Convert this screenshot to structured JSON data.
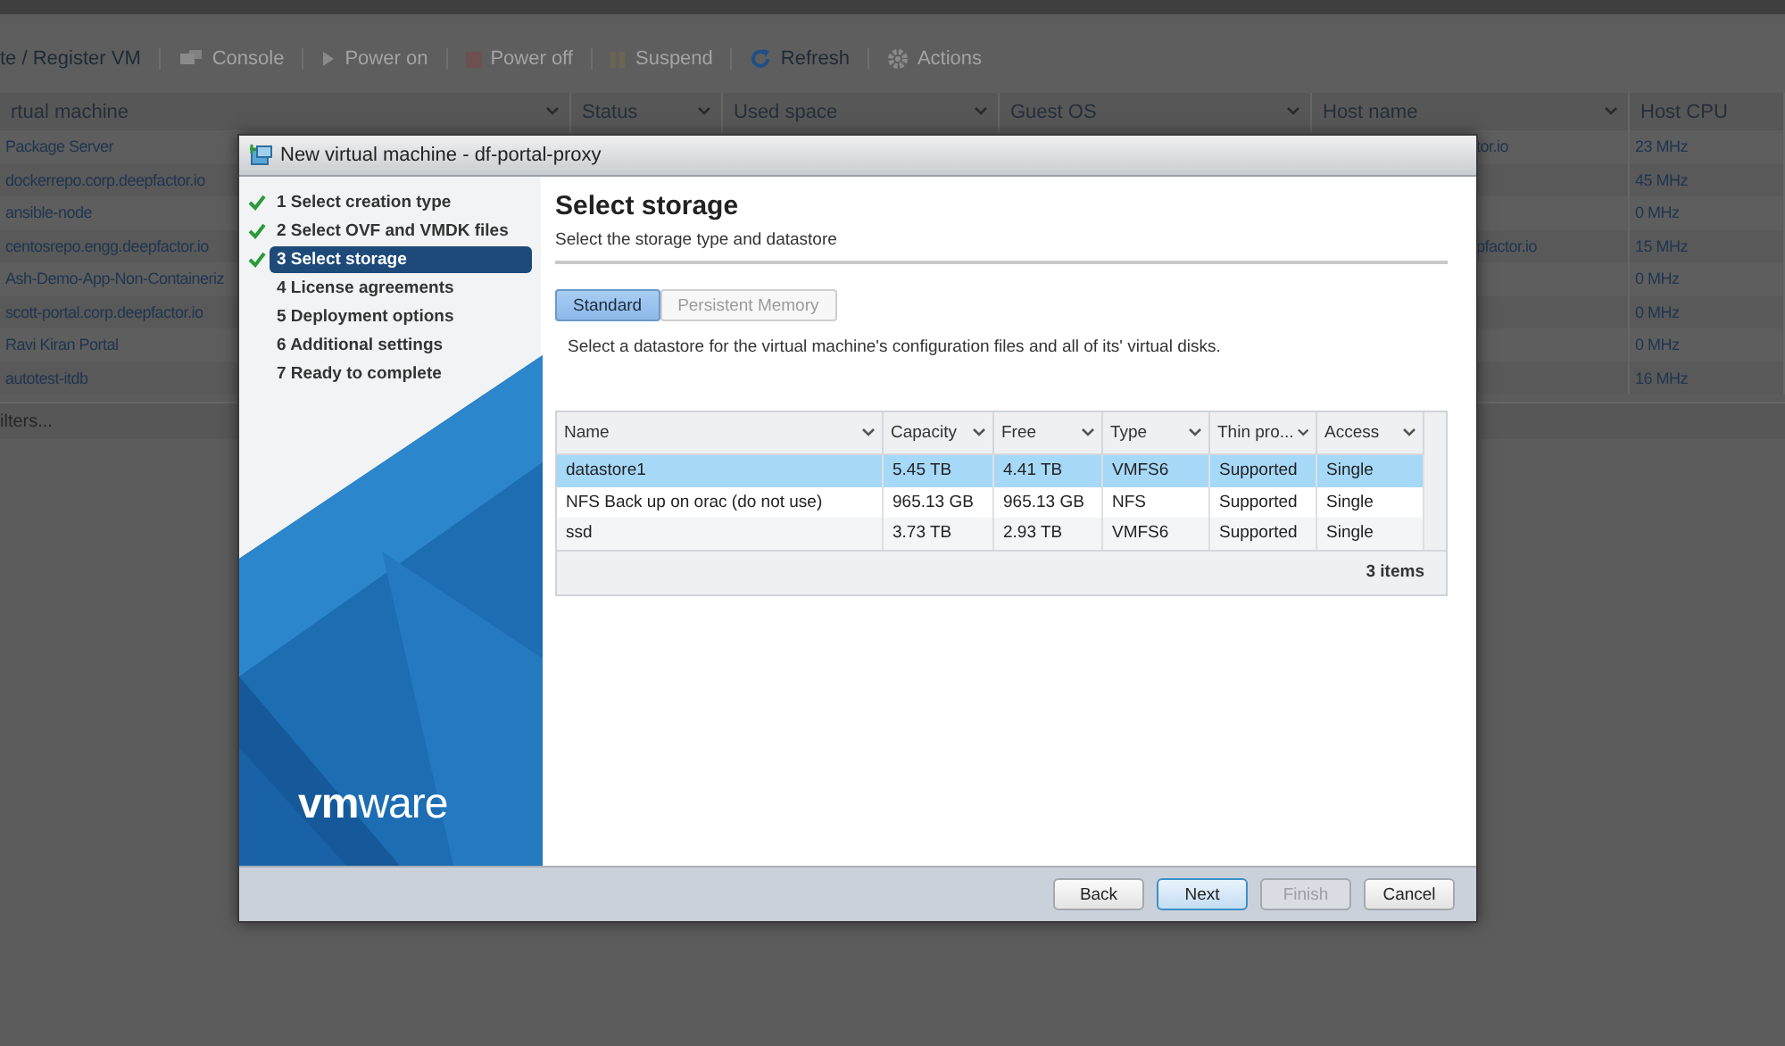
{
  "toolbar": [
    {
      "label": "te / Register VM",
      "kind": "plain",
      "disabled": false
    },
    {
      "label": "Console",
      "kind": "console",
      "disabled": true
    },
    {
      "label": "Power on",
      "kind": "play",
      "disabled": true
    },
    {
      "label": "Power off",
      "kind": "stop",
      "disabled": true
    },
    {
      "label": "Suspend",
      "kind": "pause",
      "disabled": true
    },
    {
      "label": "Refresh",
      "kind": "refresh",
      "disabled": false
    },
    {
      "label": "Actions",
      "kind": "gear",
      "disabled": true
    }
  ],
  "vm_table": {
    "columns": [
      "rtual machine",
      "Status",
      "Used space",
      "Guest OS",
      "Host name",
      "Host CPU"
    ],
    "rows": [
      [
        "Package Server",
        "",
        "",
        "",
        "tor.io",
        "23 MHz"
      ],
      [
        "dockerrepo.corp.deepfactor.io",
        "",
        "",
        "",
        "",
        "45 MHz"
      ],
      [
        "ansible-node",
        "",
        "",
        "",
        "",
        "0 MHz"
      ],
      [
        "centosrepo.engg.deepfactor.io",
        "",
        "",
        "",
        "pfactor.io",
        "15 MHz"
      ],
      [
        "Ash-Demo-App-Non-Containeriz",
        "",
        "",
        "",
        "",
        "0 MHz"
      ],
      [
        "scott-portal.corp.deepfactor.io",
        "",
        "",
        "",
        "",
        "0 MHz"
      ],
      [
        "Ravi Kiran Portal",
        "",
        "",
        "",
        "",
        "0 MHz"
      ],
      [
        "autotest-itdb",
        "",
        "",
        "",
        "",
        "16 MHz"
      ]
    ],
    "filter": "ilters..."
  },
  "dialog": {
    "title": "New virtual machine - df-portal-proxy",
    "steps": [
      {
        "label": "1 Select creation type",
        "done": true,
        "selected": false
      },
      {
        "label": "2 Select OVF and VMDK files",
        "done": true,
        "selected": false
      },
      {
        "label": "3 Select storage",
        "done": true,
        "selected": true
      },
      {
        "label": "4 License agreements",
        "done": false,
        "selected": false
      },
      {
        "label": "5 Deployment options",
        "done": false,
        "selected": false
      },
      {
        "label": "6 Additional settings",
        "done": false,
        "selected": false
      },
      {
        "label": "7 Ready to complete",
        "done": false,
        "selected": false
      }
    ],
    "logo": "**vm**ware",
    "heading": "Select storage",
    "subtitle": "Select the storage type and datastore",
    "tabs": [
      {
        "label": "Standard",
        "selected": true
      },
      {
        "label": "Persistent Memory",
        "selected": false
      }
    ],
    "description": "Select a datastore for the virtual machine's configuration files and all of its' virtual disks.",
    "datastores": {
      "columns": [
        "Name",
        "Capacity",
        "Free",
        "Type",
        "Thin pro...",
        "Access"
      ],
      "rows": [
        {
          "cells": [
            "datastore1",
            "5.45 TB",
            "4.41 TB",
            "VMFS6",
            "Supported",
            "Single"
          ],
          "selected": true
        },
        {
          "cells": [
            "NFS Back up on orac (do not use)",
            "965.13 GB",
            "965.13 GB",
            "NFS",
            "Supported",
            "Single"
          ],
          "selected": false
        },
        {
          "cells": [
            "ssd",
            "3.73 TB",
            "2.93 TB",
            "VMFS6",
            "Supported",
            "Single"
          ],
          "selected": false
        }
      ],
      "count": "3 items"
    },
    "buttons": [
      {
        "label": "Back",
        "primary": false,
        "disabled": false
      },
      {
        "label": "Next",
        "primary": true,
        "disabled": false
      },
      {
        "label": "Finish",
        "primary": false,
        "disabled": true
      },
      {
        "label": "Cancel",
        "primary": false,
        "disabled": false
      }
    ]
  }
}
